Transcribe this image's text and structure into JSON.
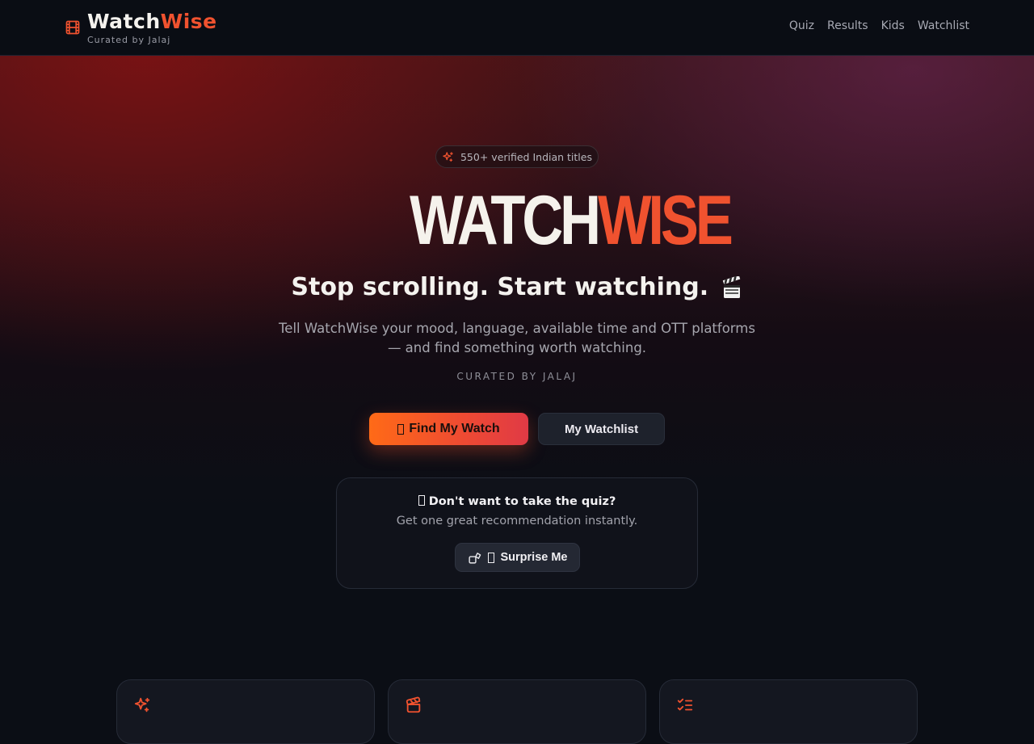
{
  "header": {
    "brand_part1": "Watch",
    "brand_part2": "Wise",
    "brand_sub": "Curated by Jalaj",
    "nav": [
      "Quiz",
      "Results",
      "Kids",
      "Watchlist"
    ]
  },
  "hero": {
    "badge": "550+ verified Indian titles",
    "logo_part1": "WATCH",
    "logo_part2": "WISE",
    "tagline": "Stop scrolling. Start watching.",
    "description": "Tell WatchWise your mood, language, available time and OTT platforms — and find something worth watching.",
    "curated": "CURATED BY JALAJ",
    "primary_button": "Find My Watch",
    "secondary_button": "My Watchlist"
  },
  "surprise": {
    "title": "Don't want to take the quiz?",
    "subtitle": "Get one great recommendation instantly.",
    "button": "Surprise Me"
  },
  "features": [
    {
      "icon": "sparkles-icon",
      "label": ""
    },
    {
      "icon": "clapperboard-icon",
      "label": ""
    },
    {
      "icon": "list-checks-icon",
      "label": ""
    }
  ],
  "colors": {
    "accent": "#f0522f",
    "background": "#0b0e15",
    "gradient_start": "#ff6a17",
    "gradient_end": "#e03a45"
  }
}
